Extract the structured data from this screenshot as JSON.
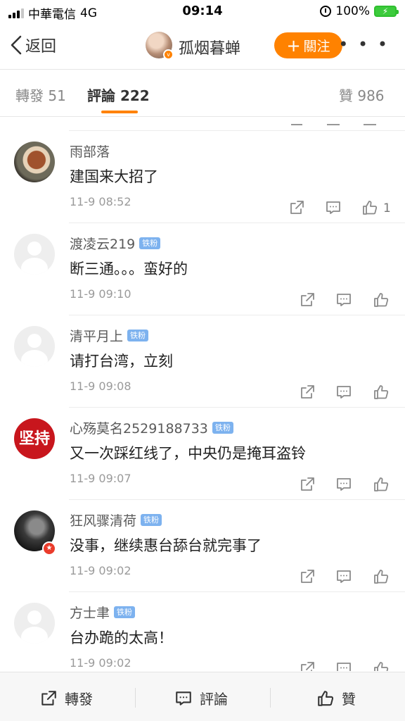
{
  "status_bar": {
    "carrier": "中華電信",
    "network": "4G",
    "time": "09:14",
    "battery": "100%"
  },
  "nav": {
    "back_label": "返回",
    "user_name": "孤烟暮蝉",
    "follow_label": "關注",
    "more_label": "• • •"
  },
  "tabs": {
    "repost": "轉發 51",
    "comments": "評論 222",
    "likes": "贊 986"
  },
  "comments": [
    {
      "name": "雨部落",
      "badge": "",
      "text": "建国来大招了",
      "time": "11-9 08:52",
      "likes": "1",
      "avatar": "food-photo"
    },
    {
      "name": "渡凌云219",
      "badge": "铁粉",
      "text": "断三通。。。蛮好的",
      "time": "11-9 09:10",
      "likes": "",
      "avatar": "default"
    },
    {
      "name": "清平月上",
      "badge": "铁粉",
      "text": "请打台湾，立刻",
      "time": "11-9 09:08",
      "likes": "",
      "avatar": "default"
    },
    {
      "name": "心殇莫名2529188733",
      "badge": "铁粉",
      "text": "又一次踩红线了，中央仍是掩耳盗铃",
      "time": "11-9 09:07",
      "likes": "",
      "avatar": "red-calligraphy",
      "avatar_text": "坚持"
    },
    {
      "name": "狂风骤清荷",
      "badge": "铁粉",
      "text": "没事，继续惠台舔台就完事了",
      "time": "11-9 09:02",
      "likes": "",
      "avatar": "dark-portrait"
    },
    {
      "name": "方士聿",
      "badge": "铁粉",
      "text": "台办跪的太高！",
      "time": "11-9 09:02",
      "likes": "",
      "avatar": "default"
    }
  ],
  "bottom_bar": {
    "repost": "轉發",
    "comment": "評論",
    "like": "贊"
  },
  "colors": {
    "accent": "#ff8200",
    "fan_badge": "#7db2ef",
    "time_text": "#9a9a9a"
  }
}
